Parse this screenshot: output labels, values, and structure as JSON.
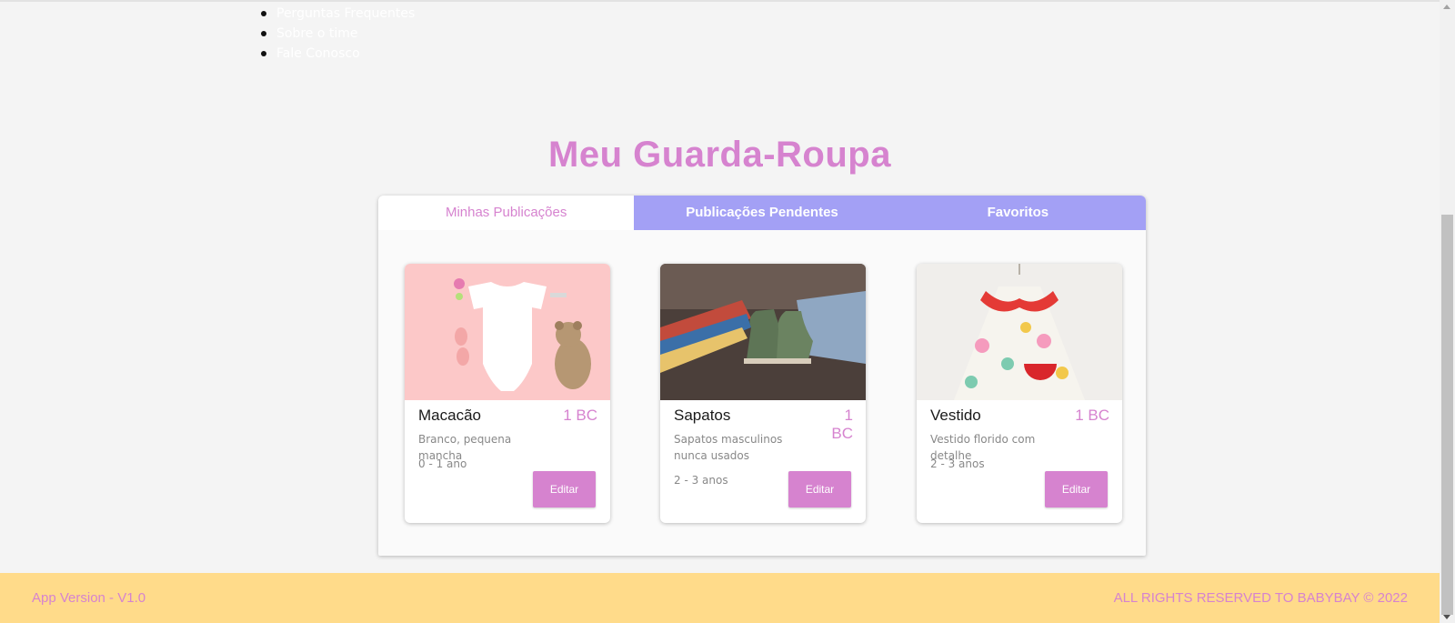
{
  "nav": {
    "items": [
      {
        "label": "Perguntas Frequentes"
      },
      {
        "label": "Sobre o time"
      },
      {
        "label": "Fale Conosco"
      }
    ]
  },
  "page": {
    "title": "Meu Guarda-Roupa"
  },
  "tabs": [
    {
      "label": "Minhas Publicações",
      "active": true
    },
    {
      "label": "Publicações Pendentes",
      "active": false
    },
    {
      "label": "Favoritos",
      "active": false
    }
  ],
  "cards": [
    {
      "name": "Macacão",
      "price": "1 BC",
      "description": "Branco, pequena mancha",
      "age": "0 - 1 ano",
      "button": "Editar",
      "image": "white-baby-bodysuit-with-teddy-bear-photo"
    },
    {
      "name": "Sapatos",
      "price": "1 BC",
      "description": "Sapatos masculinos nunca usados",
      "age": "2 - 3 anos",
      "button": "Editar",
      "image": "green-baby-shoes-photo"
    },
    {
      "name": "Vestido",
      "price": "1 BC",
      "description": "Vestido florido com detalhe",
      "age": "2 - 3 anos",
      "button": "Editar",
      "image": "floral-baby-dress-photo"
    }
  ],
  "footer": {
    "version": "App Version - V1.0",
    "rights": "ALL RIGHTS RESERVED TO BABYBAY © 2022"
  },
  "colors": {
    "accent": "#d683cf",
    "tab_inactive": "#a3a0f5",
    "footer_bg": "#ffdb8a",
    "page_bg": "#f4f4f4"
  }
}
